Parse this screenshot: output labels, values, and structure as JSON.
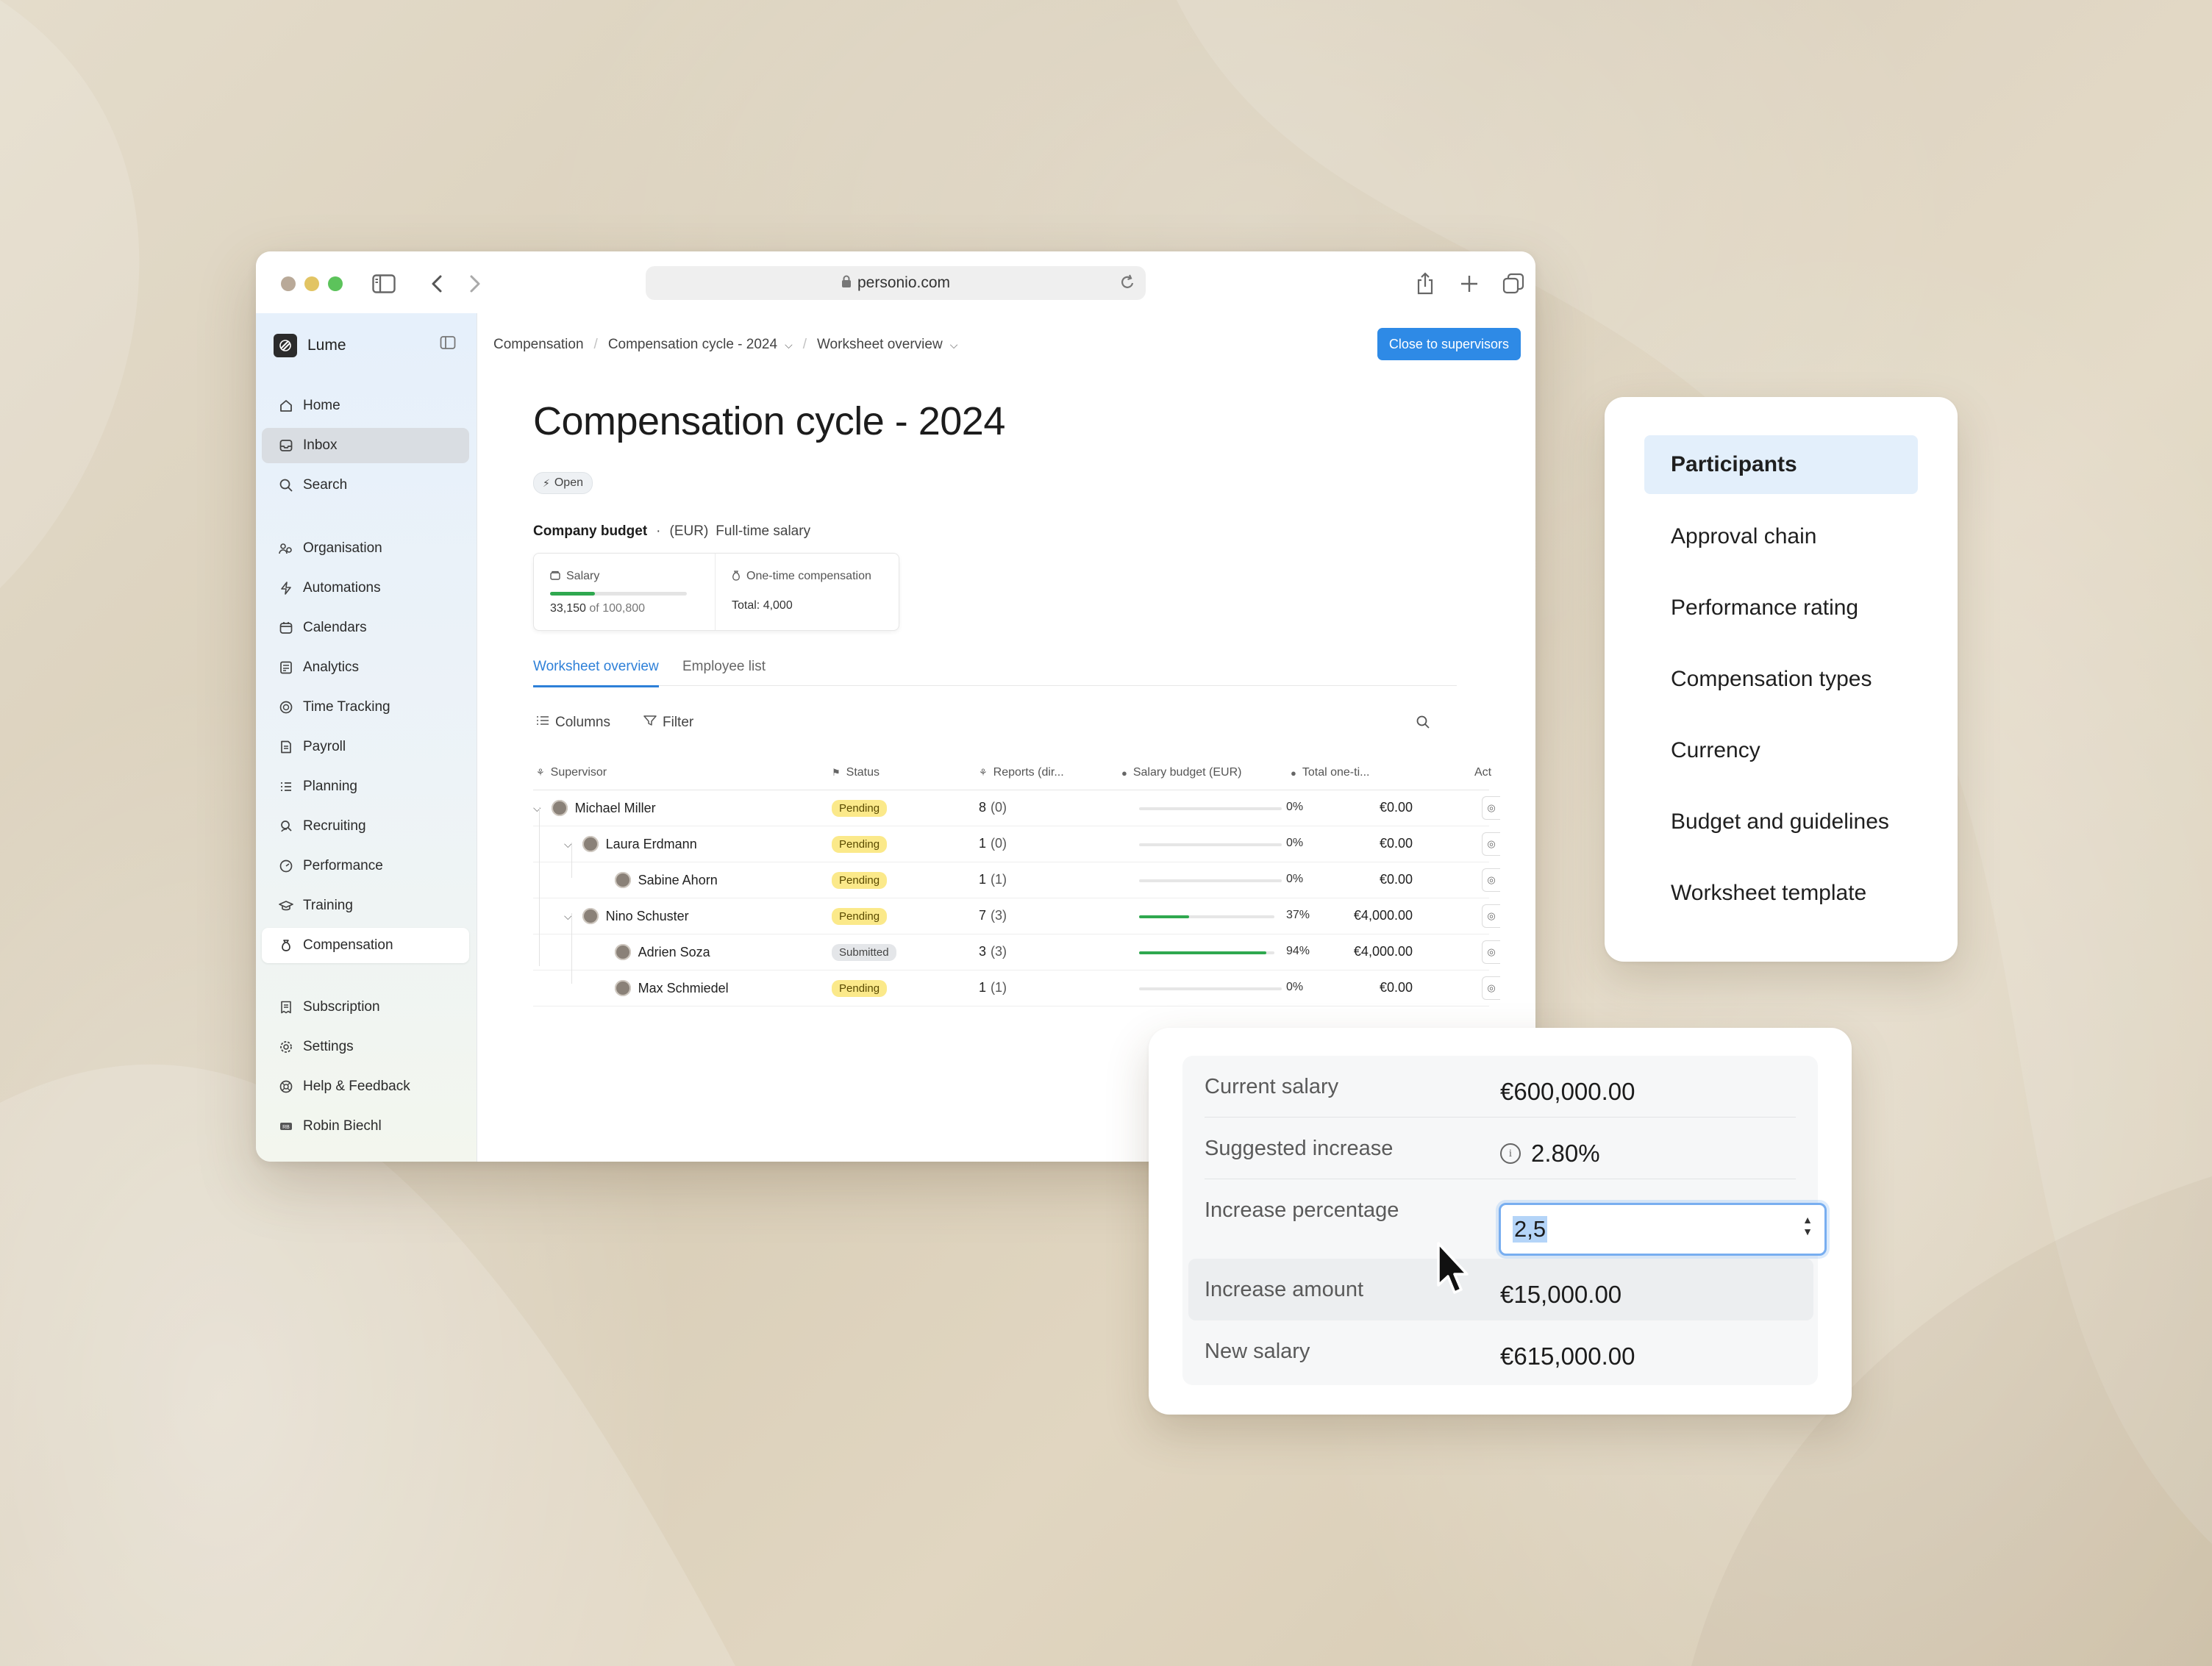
{
  "browser": {
    "url": "personio.com",
    "icons": [
      "sidebar-toggle-icon",
      "back-icon",
      "forward-icon",
      "lock-icon",
      "reload-icon",
      "share-icon",
      "new-tab-icon",
      "tabs-icon"
    ]
  },
  "sidebar": {
    "workspace": "Lume",
    "groups": [
      [
        "Home",
        "Inbox",
        "Search"
      ],
      [
        "Organisation",
        "Automations",
        "Calendars",
        "Analytics",
        "Time Tracking",
        "Payroll",
        "Planning",
        "Recruiting",
        "Performance",
        "Training",
        "Compensation"
      ],
      [
        "Subscription",
        "Settings",
        "Help & Feedback",
        "Robin Biechl"
      ]
    ],
    "items": {
      "home": "Home",
      "inbox": "Inbox",
      "search": "Search",
      "organisation": "Organisation",
      "automations": "Automations",
      "calendars": "Calendars",
      "analytics": "Analytics",
      "time_tracking": "Time Tracking",
      "payroll": "Payroll",
      "planning": "Planning",
      "recruiting": "Recruiting",
      "performance": "Performance",
      "training": "Training",
      "compensation": "Compensation",
      "subscription": "Subscription",
      "settings": "Settings",
      "help": "Help & Feedback",
      "user": "Robin Biechl"
    },
    "selected": [
      "Inbox",
      "Compensation"
    ]
  },
  "header": {
    "breadcrumb": [
      "Compensation",
      "Compensation cycle - 2024",
      "Worksheet overview"
    ],
    "primary_action": "Close to supervisors"
  },
  "page": {
    "title": "Compensation cycle - 2024",
    "status": "Open",
    "budget": {
      "label": "Company budget",
      "dot": "·",
      "currency": "(EUR)",
      "scope": "Full-time salary",
      "salary_label": "Salary",
      "salary_used": "33,150",
      "salary_of": "of",
      "salary_total": "100,800",
      "salary_fraction": 0.329,
      "onetime_label": "One-time compensation",
      "onetime_total": "Total: 4,000"
    },
    "tabs": [
      "Worksheet overview",
      "Employee list"
    ],
    "active_tab": "Worksheet overview",
    "toolbar": {
      "columns": "Columns",
      "filter": "Filter"
    }
  },
  "table": {
    "columns": {
      "supervisor": "Supervisor",
      "status": "Status",
      "reports": "Reports (dir...",
      "salary_budget": "Salary budget (EUR)",
      "total_onetime": "Total one-ti...",
      "actions": "Act"
    },
    "rows": [
      {
        "name": "Michael Miller",
        "status": "Pending",
        "reports": "8",
        "direct": "(0)",
        "budget_pct": "0%",
        "budget_fraction": 0.0,
        "total": "€0.00",
        "level": 0,
        "expandable": true
      },
      {
        "name": "Laura Erdmann",
        "status": "Pending",
        "reports": "1",
        "direct": "(0)",
        "budget_pct": "0%",
        "budget_fraction": 0.0,
        "total": "€0.00",
        "level": 1,
        "expandable": true
      },
      {
        "name": "Sabine Ahorn",
        "status": "Pending",
        "reports": "1",
        "direct": "(1)",
        "budget_pct": "0%",
        "budget_fraction": 0.0,
        "total": "€0.00",
        "level": 2,
        "expandable": false
      },
      {
        "name": "Nino Schuster",
        "status": "Pending",
        "reports": "7",
        "direct": "(3)",
        "budget_pct": "37%",
        "budget_fraction": 0.37,
        "total": "€4,000.00",
        "level": 1,
        "expandable": true
      },
      {
        "name": "Adrien Soza",
        "status": "Submitted",
        "reports": "3",
        "direct": "(3)",
        "budget_pct": "94%",
        "budget_fraction": 0.94,
        "total": "€4,000.00",
        "level": 2,
        "expandable": false
      },
      {
        "name": "Max Schmiedel",
        "status": "Pending",
        "reports": "1",
        "direct": "(1)",
        "budget_pct": "0%",
        "budget_fraction": 0.0,
        "total": "€0.00",
        "level": 2,
        "expandable": false
      }
    ]
  },
  "settings_menu": {
    "items": [
      "Participants",
      "Approval chain",
      "Performance rating",
      "Compensation types",
      "Currency",
      "Budget and guidelines",
      "Worksheet template"
    ],
    "active": "Participants"
  },
  "calculator": {
    "current_salary_label": "Current salary",
    "current_salary": "€600,000.00",
    "suggested_increase_label": "Suggested increase",
    "suggested_increase": "2.80%",
    "increase_percentage_label": "Increase percentage",
    "increase_percentage_value": "2,5",
    "increase_amount_label": "Increase amount",
    "increase_amount": "€15,000.00",
    "new_salary_label": "New salary",
    "new_salary": "€615,000.00"
  },
  "colors": {
    "accent": "#2e8ae6",
    "pending": "#fbe98a",
    "submitted": "#e4e6e9",
    "progress": "#2fa84f",
    "menu_active": "#e3effb"
  }
}
